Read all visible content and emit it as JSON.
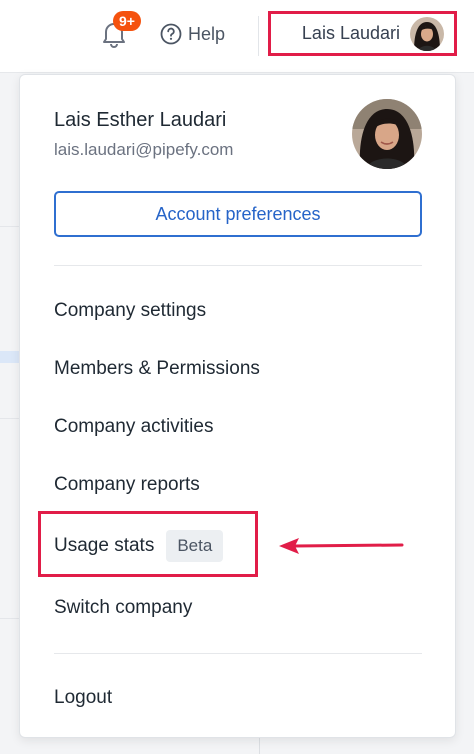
{
  "topbar": {
    "notifications_badge": "9+",
    "help_label": "Help",
    "user_label": "Lais Laudari"
  },
  "dropdown": {
    "profile": {
      "name": "Lais Esther Laudari",
      "email": "lais.laudari@pipefy.com"
    },
    "account_button": "Account preferences",
    "menu": {
      "company_settings": "Company settings",
      "members_permissions": "Members & Permissions",
      "company_activities": "Company activities",
      "company_reports": "Company reports",
      "usage_stats": "Usage stats",
      "usage_stats_badge": "Beta",
      "switch_company": "Switch company",
      "logout": "Logout"
    }
  },
  "colors": {
    "accent_blue": "#2f6fd0",
    "annotation_red": "#e11d48",
    "badge_orange": "#f5520e"
  },
  "icons": [
    "bell-icon",
    "help-circle-icon",
    "avatar",
    "arrow-left-icon"
  ]
}
